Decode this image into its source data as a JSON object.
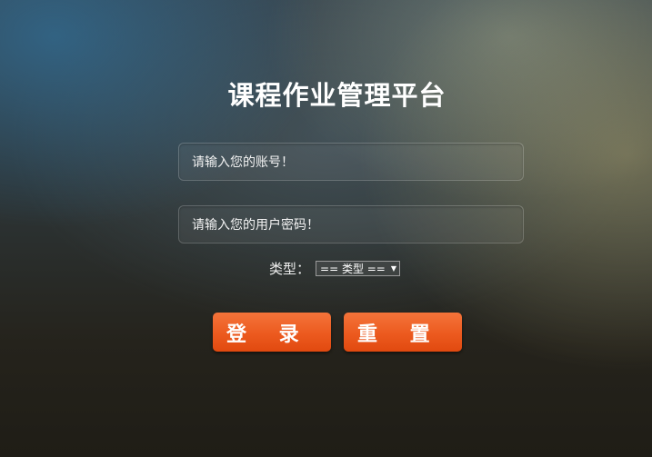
{
  "title": "课程作业管理平台",
  "form": {
    "account_placeholder": "请输入您的账号！",
    "password_placeholder": "请输入您的用户密码！",
    "type_label": "类型：",
    "type_selected": "== 类型 ==",
    "login_label": "登    录",
    "reset_label": "重    置"
  },
  "colors": {
    "button_accent": "#ec5a1f",
    "title_text": "#ffffff"
  },
  "icons": {
    "select_arrow": "dropdown-triangle-icon"
  }
}
